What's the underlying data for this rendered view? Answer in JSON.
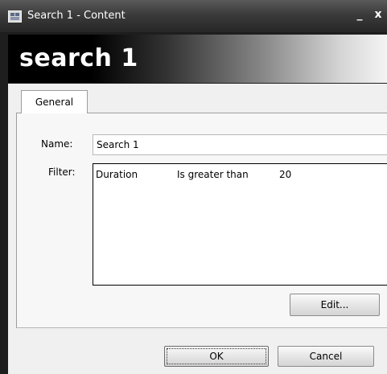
{
  "window": {
    "title": "Search 1 - Content",
    "minimize_glyph": "_",
    "close_glyph": "x",
    "icon": "window-app-icon"
  },
  "banner": {
    "title": "search 1"
  },
  "tabs": [
    {
      "label": "General",
      "active": true
    }
  ],
  "form": {
    "name_label": "Name:",
    "name_value": "Search 1",
    "filter_label": "Filter:",
    "filters": [
      {
        "field": "Duration",
        "operator": "Is greater than",
        "value": "20"
      }
    ],
    "edit_button": "Edit..."
  },
  "footer": {
    "ok_label": "OK",
    "cancel_label": "Cancel"
  }
}
